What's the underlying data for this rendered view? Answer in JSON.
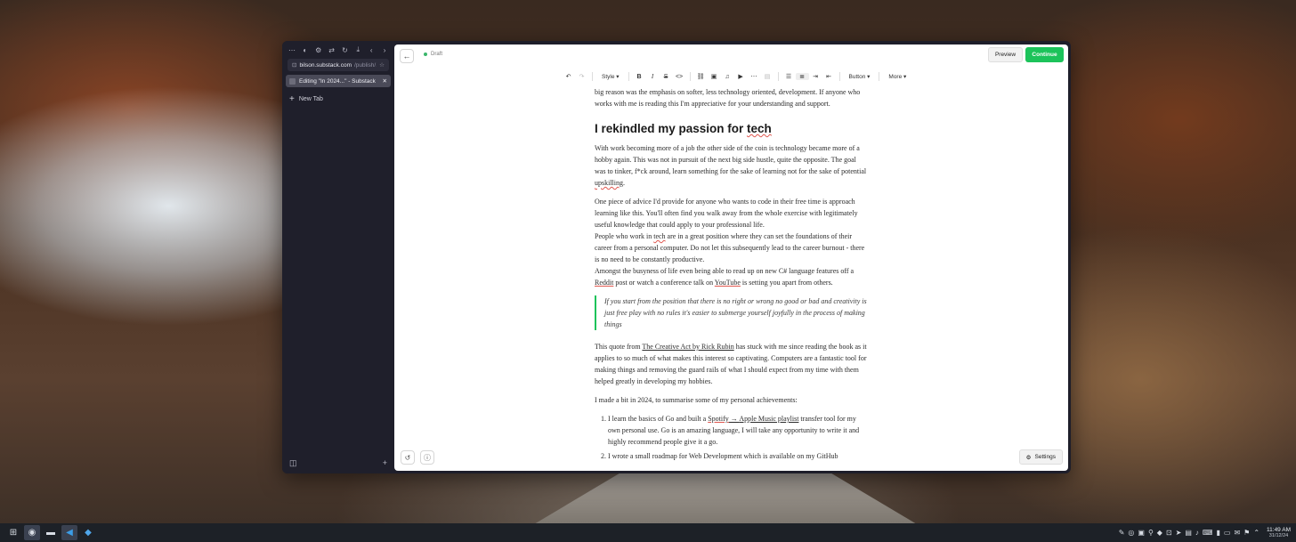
{
  "browser": {
    "url_host": "bilson.substack.com",
    "url_path": "/publish/...",
    "tab_title": "Editing \"In 2024...\" - Substack",
    "new_tab_label": "New Tab"
  },
  "editor": {
    "status": "Draft",
    "preview_label": "Preview",
    "continue_label": "Continue",
    "settings_label": "Settings",
    "toolbar": {
      "style_label": "Style",
      "button_label": "Button",
      "more_label": "More"
    }
  },
  "article": {
    "intro": "big reason was the emphasis on softer, less technology oriented, development. If anyone who works with me is reading this I'm appreciative for your understanding and support.",
    "heading_prefix": "I rekindled my passion for ",
    "heading_word": "tech",
    "p1_before": "With work becoming more of a job the other side of the coin is technology became more of a hobby again. This was not in pursuit of the next big side hustle, quite the opposite. The goal was to tinker, f*ck around, learn something for the sake of learning not for the sake of potential ",
    "p1_word": "upskilling",
    "p1_after": ".",
    "p2": "One piece of advice I'd provide for anyone who wants to code in their free time is approach learning like this. You'll often find you walk away from the whole exercise with legitimately useful knowledge that could apply to your professional life.",
    "p3_before": "People who work in ",
    "p3_word": "tech",
    "p3_after": " are in a great position where they can set the foundations of their career from a personal computer. Do not let this subsequently lead to the career burnout - there is no need to be constantly productive.",
    "p4_before": "Amongst the busyness of life even being able to read up on new C# language features off a ",
    "p4_link1": "Reddit",
    "p4_mid": " post or watch a conference talk on ",
    "p4_link2": "YouTube",
    "p4_after": " is setting you apart from others.",
    "quote": "If you start from the position that there is no right or wrong no good or bad and creativity is just free play with no rules it's easier to submerge yourself joyfully in the process of making things",
    "p5_before": "This quote from ",
    "p5_link": "The Creative Act by Rick Rubin",
    "p5_after": " has stuck with me since reading the book as it applies to so much of what makes this interest so captivating. Computers are a fantastic tool for making things and removing the guard rails of what I should expect from my time with them helped greatly in developing my hobbies.",
    "p6": "I made a bit in 2024, to summarise some of my personal achievements:",
    "li1_before": "I learn the basics of Go and built a ",
    "li1_link1": "Spotify",
    "li1_arrow": " → ",
    "li1_link2": "Apple Music playlist",
    "li1_after": " transfer tool for my own personal use. Go is an amazing language, I will take any opportunity to write it and highly recommend people give it a go.",
    "li2": "I wrote a small roadmap for Web Development which is available on my GitHub"
  },
  "taskbar": {
    "time": "11:49 AM",
    "date": "31/12/24"
  }
}
